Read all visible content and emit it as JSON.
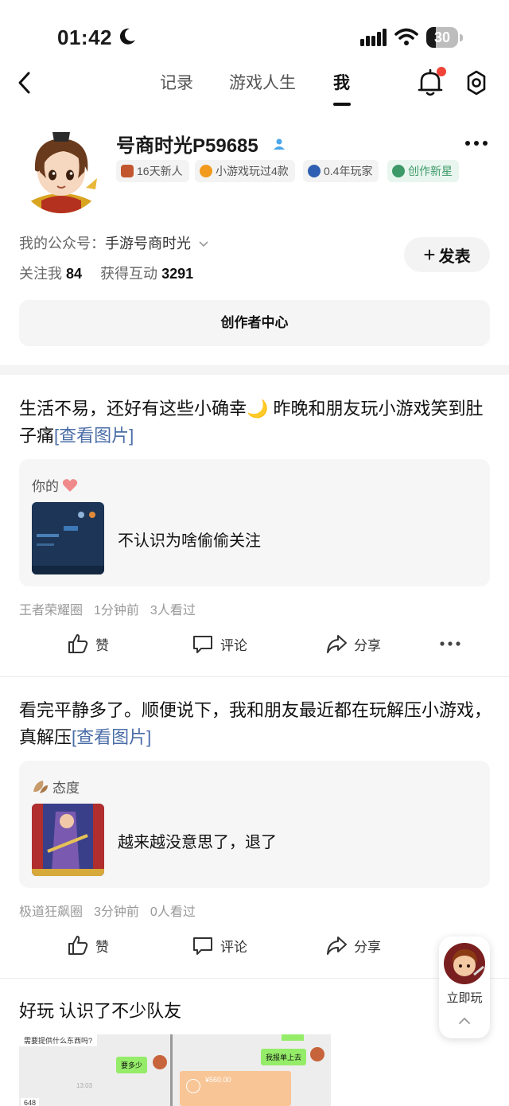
{
  "status_bar": {
    "time": "01:42",
    "battery": "30"
  },
  "nav": {
    "tabs": [
      {
        "label": "记录"
      },
      {
        "label": "游戏人生"
      },
      {
        "label": "我"
      }
    ],
    "active_tab": "我"
  },
  "profile": {
    "username": "号商时光P59685",
    "badges": [
      {
        "label": "16天新人"
      },
      {
        "label": "小游戏玩过4款"
      },
      {
        "label": "0.4年玩家"
      },
      {
        "label": "创作新星"
      }
    ],
    "public_account_label": "我的公众号：",
    "public_account_value": "手游号商时光",
    "followers_label": "关注我",
    "followers": "84",
    "interactions_label": "获得互动",
    "interactions": "3291",
    "post_button": "发表",
    "creator_center": "创作者中心"
  },
  "posts": [
    {
      "text": "生活不易，还好有这些小确幸🌙 昨晚和朋友玩小游戏笑到肚子痛",
      "link": "[查看图片]",
      "card_label": "你的",
      "card_text": "不认识为啥偷偷关注",
      "circle": "王者荣耀圈",
      "time": "1分钟前",
      "views": "3人看过"
    },
    {
      "text": "看完平静多了。顺便说下，我和朋友最近都在玩解压小游戏，真解压",
      "link": "[查看图片]",
      "card_label": "态度",
      "card_text": "越来越没意思了，退了",
      "circle": "极道狂飙圈",
      "time": "3分钟前",
      "views": "0人看过"
    },
    {
      "text": "好玩 认识了不少队友"
    }
  ],
  "actions": {
    "like": "赞",
    "comment": "评论",
    "share": "分享"
  },
  "floating": {
    "label": "立即玩"
  },
  "screenshot_chat": {
    "q1": "需要提供什么东西吗?",
    "q2": "要多少",
    "time": "13:03",
    "r1": "我报单上去",
    "amount": "¥560.00",
    "num": "648"
  },
  "colors": {
    "accent_red": "#f04438",
    "link_blue": "#4a6da7",
    "badge_green": "#3d9a68"
  }
}
